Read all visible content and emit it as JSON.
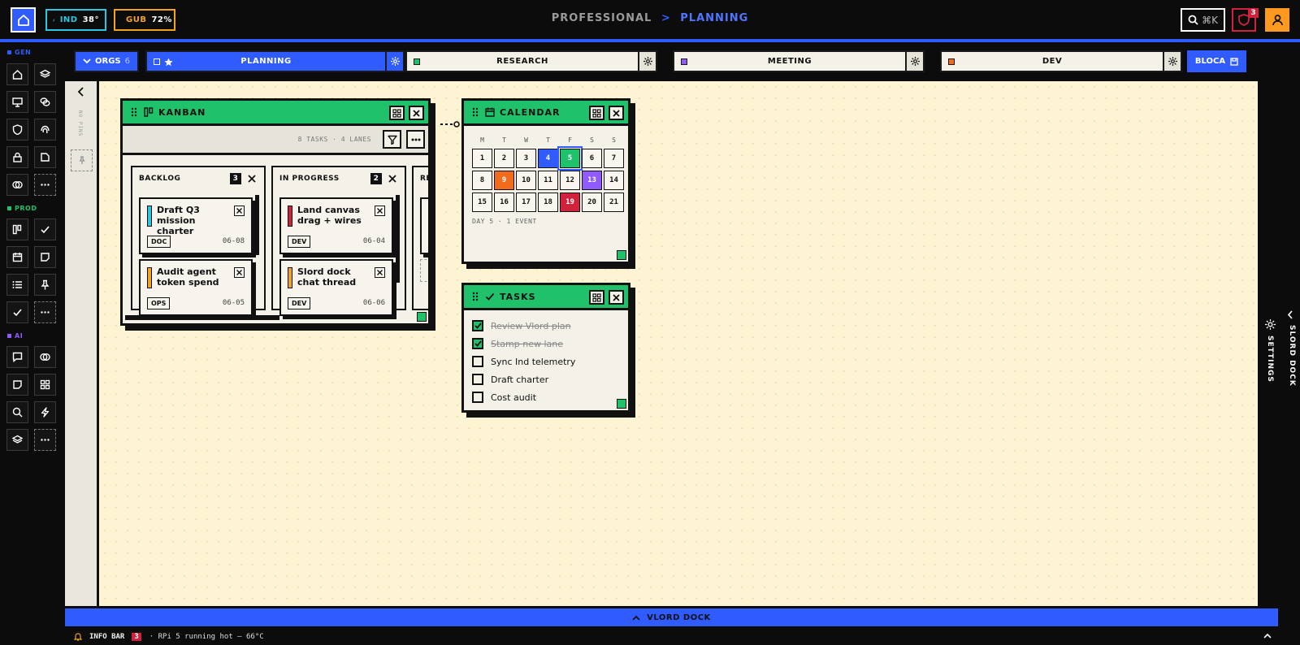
{
  "topbar": {
    "ind_label": "IND",
    "ind_value": "38°",
    "gub_label": "GUB",
    "gub_value": "72%",
    "breadcrumb_root": "PROFESSIONAL",
    "breadcrumb_sep": ">",
    "breadcrumb_current": "PLANNING",
    "search_shortcut": "⌘K",
    "alert_count": "3",
    "colors": {
      "accent": "#2f5bff",
      "ind": "#29c7e0",
      "gub": "#f3a41b",
      "alert": "#d0223c",
      "user": "#ff9a1f"
    }
  },
  "sidebar": {
    "sections": [
      {
        "label": "GEN",
        "color": "#2f5bff"
      },
      {
        "label": "PROD",
        "color": "#1fc16b"
      },
      {
        "label": "AI",
        "color": "#8f5bff"
      }
    ]
  },
  "tabs": {
    "orgs_label": "ORGS",
    "orgs_count": "6",
    "items": [
      {
        "label": "PLANNING",
        "color": "#2f5bff"
      },
      {
        "label": "RESEARCH",
        "color": "#1fc16b"
      },
      {
        "label": "MEETING",
        "color": "#8f5bff"
      },
      {
        "label": "DEV",
        "color": "#f26b1d"
      }
    ],
    "bloca_label": "BLOCA"
  },
  "canvas": {
    "leftstrip_label": "NO PINS"
  },
  "kanban": {
    "title": "KANBAN",
    "summary": "8 TASKS · 4 LANES",
    "lanes": [
      {
        "name": "BACKLOG",
        "count": "3",
        "cards": [
          {
            "title": "Draft Q3 mission charter",
            "tag": "DOC",
            "date": "06-08",
            "color": "#29c7e0"
          },
          {
            "title": "Audit agent token spend",
            "tag": "OPS",
            "date": "06-05",
            "color": "#f3a41b"
          }
        ]
      },
      {
        "name": "IN PROGRESS",
        "count": "2",
        "cards": [
          {
            "title": "Land canvas drag + wires",
            "tag": "DEV",
            "date": "06-04",
            "color": "#d0223c"
          },
          {
            "title": "Slord dock chat thread",
            "tag": "DEV",
            "date": "06-06",
            "color": "#f3a41b"
          }
        ]
      },
      {
        "name": "REVI",
        "cards": [
          {
            "tag": "CO",
            "color": "#29c7e0"
          }
        ]
      }
    ]
  },
  "calendar": {
    "title": "CALENDAR",
    "weekdays": [
      "M",
      "T",
      "W",
      "T",
      "F",
      "S",
      "S"
    ],
    "days": [
      "1",
      "2",
      "3",
      "4",
      "5",
      "6",
      "7",
      "8",
      "9",
      "10",
      "11",
      "12",
      "13",
      "14",
      "15",
      "16",
      "17",
      "18",
      "19",
      "20",
      "21"
    ],
    "highlights": {
      "4": "#2f5bff",
      "5": "#1fc16b",
      "9": "#f26b1d",
      "13": "#8f5bff",
      "19": "#d0223c"
    },
    "status": "DAY 5 · 1 EVENT"
  },
  "tasks": {
    "title": "TASKS",
    "items": [
      {
        "label": "Review Vlord plan",
        "done": true
      },
      {
        "label": "Stamp new lane",
        "done": true
      },
      {
        "label": "Sync Ind telemetry",
        "done": false
      },
      {
        "label": "Draft charter",
        "done": false
      },
      {
        "label": "Cost audit",
        "done": false
      }
    ]
  },
  "rightdock": {
    "settings_label": "SETTINGS",
    "dock_label": "SLORD DOCK"
  },
  "bottom": {
    "vlord_label": "VLORD DOCK",
    "info_label": "INFO BAR",
    "info_count": "3",
    "info_message": "· RPi 5 running hot — 66°C"
  }
}
